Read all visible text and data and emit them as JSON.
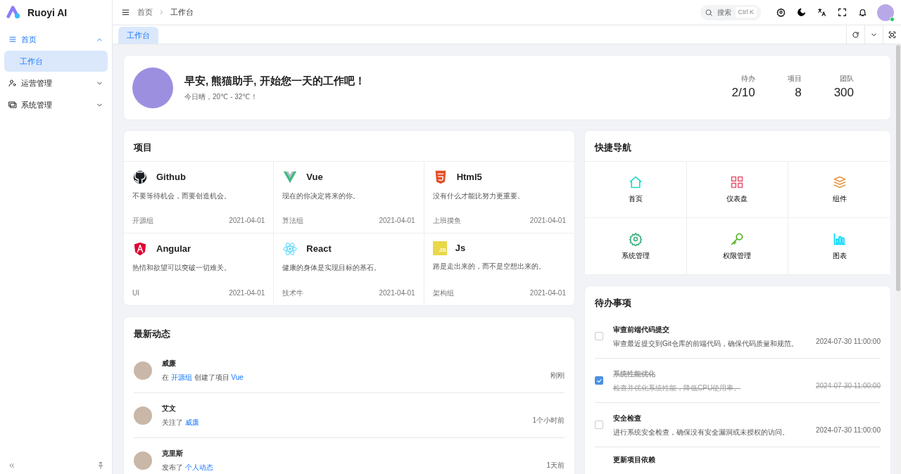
{
  "app": {
    "name": "Ruoyi AI"
  },
  "sidebar": {
    "items": [
      {
        "label": "首页",
        "kind": "menu",
        "expanded": true,
        "selected": true,
        "children": [
          {
            "label": "工作台",
            "selected": true
          }
        ]
      },
      {
        "label": "运营管理",
        "kind": "people",
        "expanded": false,
        "selected": false
      },
      {
        "label": "系统管理",
        "kind": "monitor",
        "expanded": false,
        "selected": false
      }
    ]
  },
  "header": {
    "breadcrumb": [
      "首页",
      "工作台"
    ],
    "search": {
      "placeholder": "搜索",
      "shortcut": "Ctrl K"
    },
    "user_online": true
  },
  "tabs": [
    {
      "label": "工作台",
      "selected": true
    }
  ],
  "welcome": {
    "title": "早安, 熊猫助手, 开始您一天的工作吧！",
    "subtitle": "今日晴，20℃ - 32℃！",
    "stats": [
      {
        "label": "待办",
        "value": "2/10"
      },
      {
        "label": "项目",
        "value": "8"
      },
      {
        "label": "团队",
        "value": "300"
      }
    ]
  },
  "projects": {
    "title": "项目",
    "items": [
      {
        "kind": "github",
        "name": "Github",
        "desc": "不要等待机会，而要创造机会。",
        "group": "开源组",
        "date": "2021-04-01"
      },
      {
        "kind": "vue",
        "name": "Vue",
        "desc": "现在的你决定将来的你。",
        "group": "算法组",
        "date": "2021-04-01"
      },
      {
        "kind": "html",
        "name": "Html5",
        "desc": "没有什么才能比努力更重要。",
        "group": "上班摸鱼",
        "date": "2021-04-01"
      },
      {
        "kind": "angular",
        "name": "Angular",
        "desc": "热情和欲望可以突破一切难关。",
        "group": "UI",
        "date": "2021-04-01"
      },
      {
        "kind": "react",
        "name": "React",
        "desc": "健康的身体是实现目标的基石。",
        "group": "技术牛",
        "date": "2021-04-01"
      },
      {
        "kind": "js",
        "name": "Js",
        "icon_text": "JS",
        "desc": "路是走出来的，而不是空想出来的。",
        "group": "架构组",
        "date": "2021-04-01"
      }
    ]
  },
  "quick_nav": {
    "title": "快捷导航",
    "items": [
      {
        "kind": "home",
        "label": "首页",
        "color": "#1fdaca"
      },
      {
        "kind": "grid",
        "label": "仪表盘",
        "color": "#e85f79"
      },
      {
        "kind": "layers",
        "label": "组件",
        "color": "#e49a48"
      },
      {
        "kind": "gear",
        "label": "系统管理",
        "color": "#3fb27f"
      },
      {
        "kind": "key",
        "label": "权限管理",
        "color": "#4daf1b"
      },
      {
        "kind": "chart",
        "label": "图表",
        "color": "#00d8ff"
      }
    ]
  },
  "activity": {
    "title": "最新动态",
    "items": [
      {
        "name": "威廉",
        "parts": [
          {
            "text": "在 "
          },
          {
            "link": "开源组"
          },
          {
            "text": " 创建了项目 "
          },
          {
            "link": "Vue"
          }
        ],
        "time": "刚刚"
      },
      {
        "name": "艾文",
        "parts": [
          {
            "text": "关注了 "
          },
          {
            "link": "威廉"
          }
        ],
        "time": "1个小时前"
      },
      {
        "name": "克里斯",
        "parts": [
          {
            "text": "发布了 "
          },
          {
            "link": "个人动态"
          }
        ],
        "time": "1天前"
      }
    ]
  },
  "todo": {
    "title": "待办事项",
    "items": [
      {
        "title": "审查前端代码提交",
        "desc": "审查最近提交到Git仓库的前端代码，确保代码质量和规范。",
        "date": "2024-07-30 11:00:00",
        "checked": false
      },
      {
        "title": "系统性能优化",
        "desc": "检查并优化系统性能，降低CPU使用率。",
        "date": "2024-07-30 11:00:00",
        "checked": true
      },
      {
        "title": "安全检查",
        "desc": "进行系统安全检查，确保没有安全漏洞或未授权的访问。",
        "date": "2024-07-30 11:00:00",
        "checked": false
      },
      {
        "title": "更新项目依赖"
      }
    ]
  }
}
